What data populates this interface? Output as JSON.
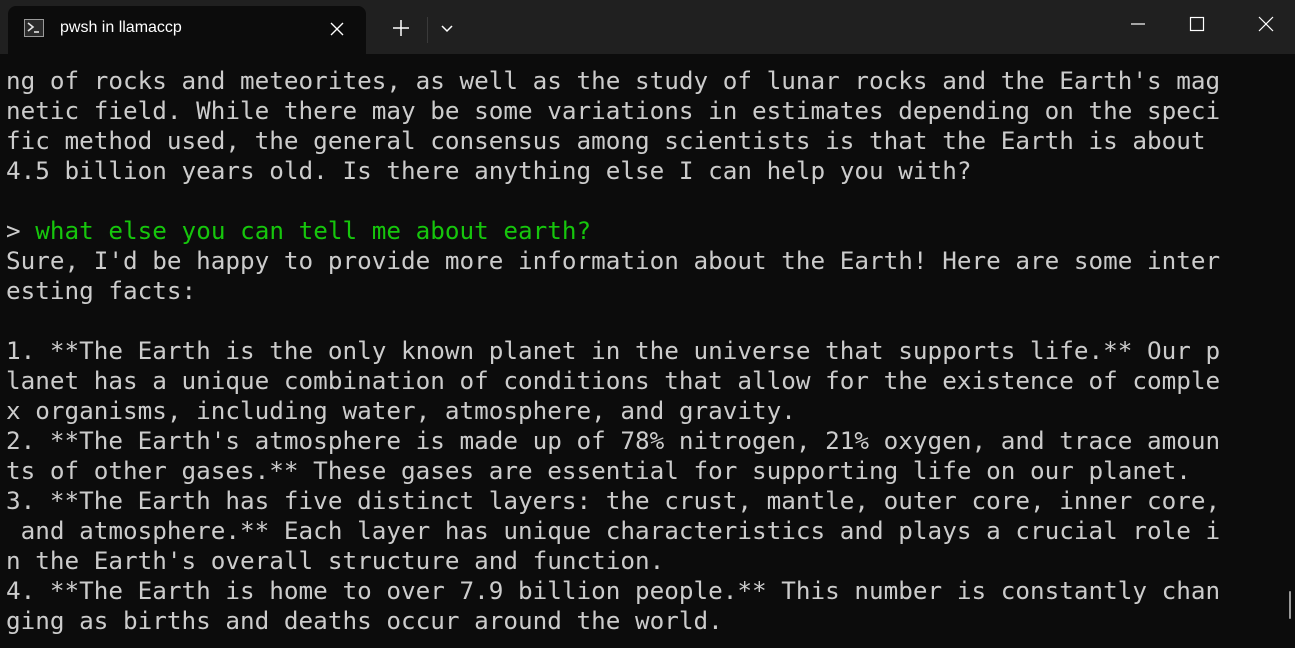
{
  "tab": {
    "title": "pwsh in llamaccp",
    "icon": "powershell-icon"
  },
  "titlebar_buttons": [
    "new-tab-icon",
    "dropdown-chevron-icon",
    "minimize-icon",
    "maximize-icon",
    "close-icon"
  ],
  "terminal": {
    "colors": {
      "background": "#0c0c0c",
      "text": "#cccccc",
      "prompt_command": "#16c60c"
    },
    "lines": [
      "ng of rocks and meteorites, as well as the study of lunar rocks and the Earth's mag",
      "netic field. While there may be some variations in estimates depending on the speci",
      "fic method used, the general consensus among scientists is that the Earth is about",
      "4.5 billion years old. Is there anything else I can help you with?",
      "",
      "",
      "Sure, I'd be happy to provide more information about the Earth! Here are some inter",
      "esting facts:",
      "",
      "1. **The Earth is the only known planet in the universe that supports life.** Our p",
      "lanet has a unique combination of conditions that allow for the existence of comple",
      "x organisms, including water, atmosphere, and gravity.",
      "2. **The Earth's atmosphere is made up of 78% nitrogen, 21% oxygen, and trace amoun",
      "ts of other gases.** These gases are essential for supporting life on our planet.",
      "3. **The Earth has five distinct layers: the crust, mantle, outer core, inner core,",
      " and atmosphere.** Each layer has unique characteristics and plays a crucial role i",
      "n the Earth's overall structure and function.",
      "4. **The Earth is home to over 7.9 billion people.** This number is constantly chan",
      "ging as births and deaths occur around the world."
    ],
    "prompt": {
      "symbol": ">",
      "command": "what else you can tell me about earth?"
    }
  }
}
